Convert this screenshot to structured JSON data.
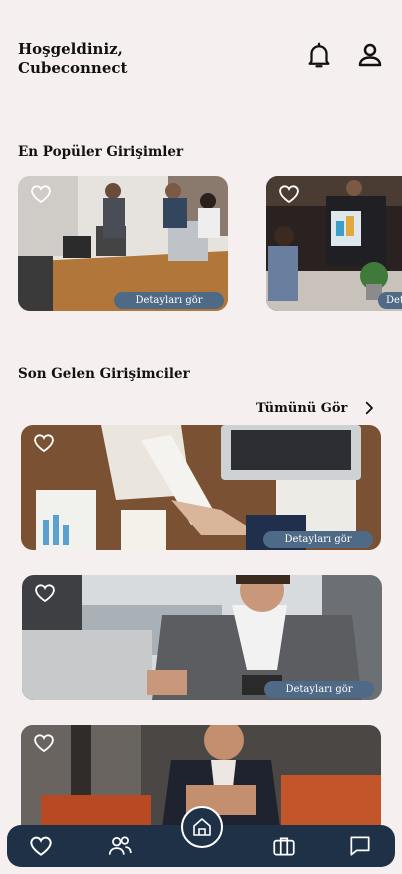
{
  "header": {
    "greeting_line1": "Hoşgeldiniz,",
    "greeting_line2": "Cubeconnect",
    "bell_icon": "bell-icon",
    "profile_icon": "user-icon"
  },
  "popular": {
    "title": "En Popüler Girişimler",
    "cards": [
      {
        "button_label": "Detayları gör"
      },
      {
        "button_label": "Detayları gör"
      }
    ]
  },
  "recent": {
    "title": "Son Gelen Girişimciler",
    "see_all_label": "Tümünü Gör",
    "cards": [
      {
        "button_label": "Detayları gör"
      },
      {
        "button_label": "Detayları gör"
      },
      {
        "button_label": ""
      }
    ]
  },
  "bottom_nav": {
    "items": [
      "heart-icon",
      "users-icon",
      "home-icon",
      "briefcase-icon",
      "chat-icon"
    ],
    "background": "#1e3147"
  },
  "colors": {
    "background": "#f5eff0",
    "button": "#4f6a86"
  }
}
